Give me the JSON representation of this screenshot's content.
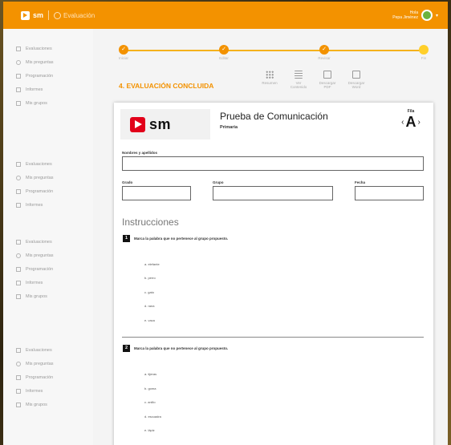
{
  "topbar": {
    "brand": "sm",
    "app_name": "Evaluación",
    "user_line1": "Hola",
    "user_line2": "Pepa Jiménez"
  },
  "sidebar": {
    "groups": [
      {
        "items": [
          "Evaluaciones",
          "Mis preguntas",
          "Programación",
          "Informes",
          "Mis grupos"
        ]
      },
      {
        "items": [
          "Evaluaciones",
          "Mis preguntas",
          "Programación",
          "Informes"
        ]
      },
      {
        "items": [
          "Evaluaciones",
          "Mis preguntas",
          "Programación",
          "Informes",
          "Mis grupos"
        ]
      },
      {
        "items": [
          "Evaluaciones",
          "Mis preguntas",
          "Programación",
          "Informes",
          "Mis grupos"
        ]
      }
    ]
  },
  "stepper": {
    "steps": [
      {
        "label": "Iniciar",
        "mark": "✓"
      },
      {
        "label": "Editar",
        "mark": "✓"
      },
      {
        "label": "Revisar",
        "mark": "✓"
      },
      {
        "label": "Fin",
        "mark": ""
      }
    ]
  },
  "main": {
    "status_title": "4. EVALUACIÓN CONCLUIDA",
    "tools": [
      {
        "label": "Resumen",
        "icon": "grid-icon"
      },
      {
        "label": "Ver Contenido",
        "icon": "list-icon"
      },
      {
        "label": "Descargar PDF",
        "icon": "pdf-icon"
      },
      {
        "label": "Descargar Word",
        "icon": "doc-icon"
      }
    ]
  },
  "paper": {
    "brand": "sm",
    "title": "Prueba de Comunicación",
    "subtitle": "Primaria",
    "fila_label": "Fila",
    "fila_letter": "A",
    "fields": {
      "name_label": "Nombres y apellidos",
      "grade_label": "Grado",
      "group_label": "Grupo",
      "date_label": "Fecha"
    },
    "instructions_heading": "Instrucciones",
    "questions": [
      {
        "number": "1",
        "text": "Marca la palabra que no pertenece al grupo propuesto.",
        "options": [
          "a. elefante",
          "b. perro",
          "c. gato",
          "d. rana",
          "e. vaca"
        ]
      },
      {
        "number": "2",
        "text": "Marca la palabra que no pertenece al grupo propuesto.",
        "options": [
          "a. tijeras",
          "b. goma",
          "c. anillo",
          "d. escuadra",
          "e. lápiz"
        ]
      }
    ]
  }
}
